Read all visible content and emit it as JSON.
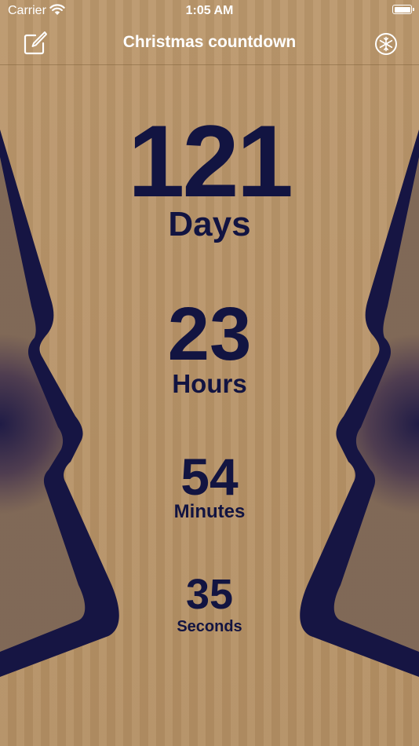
{
  "status_bar": {
    "carrier": "Carrier",
    "time": "1:05 AM"
  },
  "nav": {
    "title": "Christmas countdown",
    "left_icon": "edit-icon",
    "right_icon": "snowflake-icon"
  },
  "countdown": {
    "days": {
      "value": "121",
      "label": "Days"
    },
    "hours": {
      "value": "23",
      "label": "Hours"
    },
    "minutes": {
      "value": "54",
      "label": "Minutes"
    },
    "seconds": {
      "value": "35",
      "label": "Seconds"
    }
  },
  "colors": {
    "background": "#b9956a",
    "text": "#121441",
    "tree": "#161543"
  }
}
